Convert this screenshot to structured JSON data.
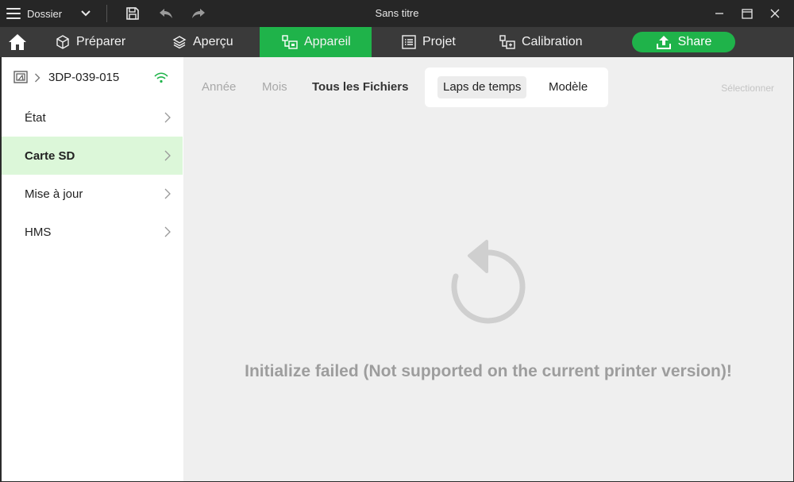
{
  "titlebar": {
    "menu_label": "Dossier",
    "title": "Sans titre",
    "icons": [
      "menu-icon",
      "chevron-down-icon",
      "save-icon",
      "undo-icon",
      "redo-icon",
      "minimize-icon",
      "maximize-icon",
      "close-icon"
    ]
  },
  "nav": {
    "tabs": [
      {
        "label": "Préparer",
        "icon": "cube-icon"
      },
      {
        "label": "Aperçu",
        "icon": "layers-icon"
      },
      {
        "label": "Appareil",
        "icon": "device-icon",
        "active": true
      },
      {
        "label": "Projet",
        "icon": "list-icon"
      },
      {
        "label": "Calibration",
        "icon": "calibration-icon"
      }
    ],
    "share_label": "Share",
    "accent": "#1fb34a"
  },
  "sidebar": {
    "device_name": "3DP-039-015",
    "items": [
      {
        "label": "État"
      },
      {
        "label": "Carte SD",
        "active": true
      },
      {
        "label": "Mise à jour"
      },
      {
        "label": "HMS"
      }
    ]
  },
  "main": {
    "filters": [
      "Année",
      "Mois",
      "Tous les Fichiers"
    ],
    "segments": [
      "Laps de temps",
      "Modèle"
    ],
    "select_label": "Sélectionner",
    "error_message": "Initialize failed (Not supported on the current printer version)!"
  }
}
